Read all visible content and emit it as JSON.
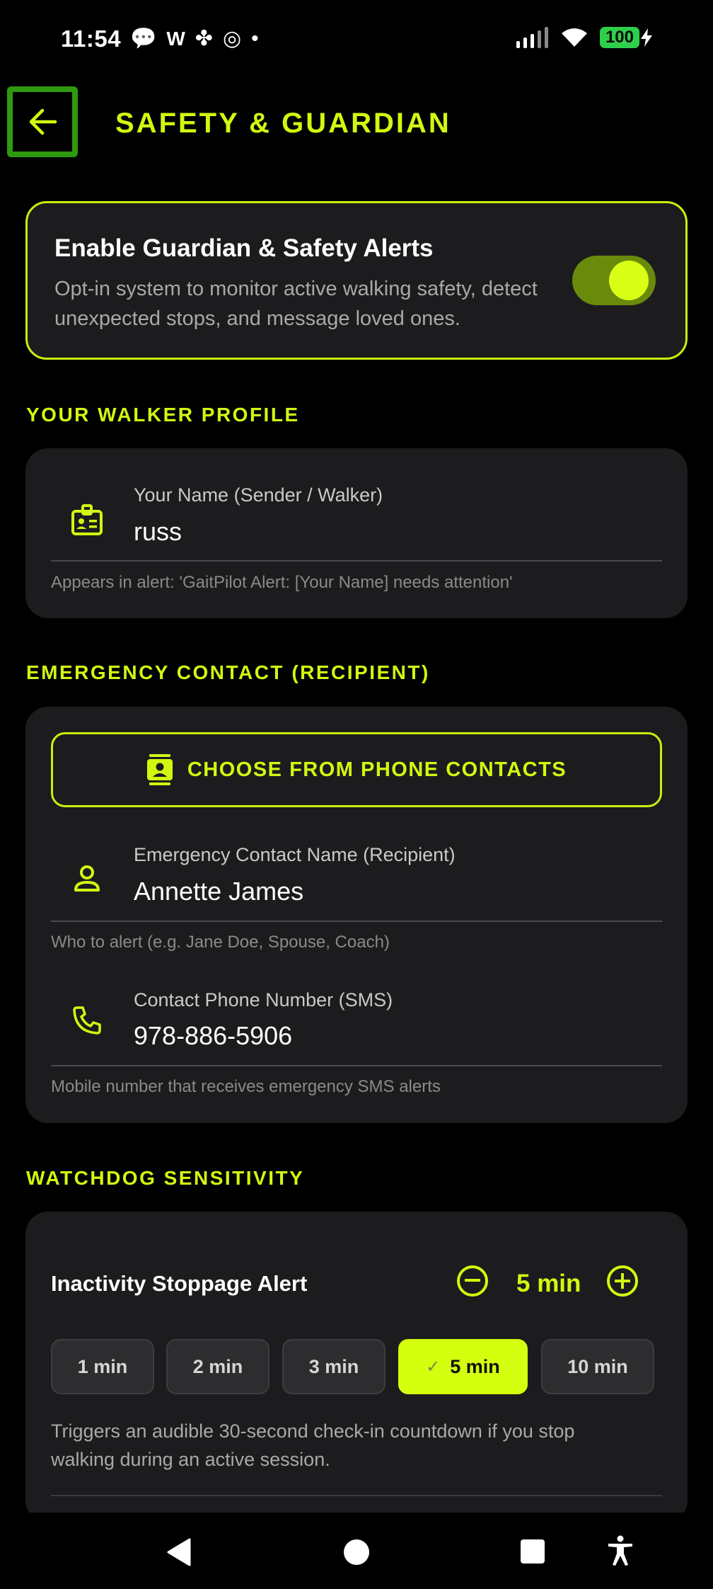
{
  "status_bar": {
    "time": "11:54",
    "notification_icons": [
      "speech-bubble-icon",
      "w-app-icon",
      "pinwheel-icon",
      "spiral-icon",
      "dot-icon"
    ],
    "notification_glyphs": [
      "💬",
      "W",
      "✤",
      "◎",
      "•"
    ],
    "battery": "100"
  },
  "header": {
    "title": "SAFETY & GUARDIAN"
  },
  "enable_card": {
    "title": "Enable Guardian & Safety Alerts",
    "description": "Opt-in system to monitor active walking safety, detect unexpected stops, and message loved ones.",
    "toggle_on": true
  },
  "walker_profile": {
    "section_title": "YOUR WALKER PROFILE",
    "name_label": "Your Name (Sender / Walker)",
    "name_value": "russ",
    "hint": "Appears in alert: 'GaitPilot Alert: [Your Name] needs attention'"
  },
  "emergency_contact": {
    "section_title": "EMERGENCY CONTACT (RECIPIENT)",
    "choose_button": "CHOOSE FROM PHONE CONTACTS",
    "name_label": "Emergency Contact Name (Recipient)",
    "name_value": "Annette James",
    "name_hint": "Who to alert (e.g. Jane Doe, Spouse, Coach)",
    "phone_label": "Contact Phone Number (SMS)",
    "phone_value": "978-886-5906",
    "phone_hint": "Mobile number that receives emergency SMS alerts"
  },
  "watchdog": {
    "section_title": "WATCHDOG SENSITIVITY",
    "inactivity_title": "Inactivity Stoppage Alert",
    "current_value": "5 min",
    "options": [
      "1 min",
      "2 min",
      "3 min",
      "5 min",
      "10 min"
    ],
    "selected_option": "5 min",
    "description": "Triggers an audible 30-second check-in countdown if you stop walking during an active session."
  },
  "colors": {
    "accent": "#d4f70f",
    "background": "#000000",
    "card": "#1c1c1e",
    "back_button_border": "#2e9a10",
    "battery": "#2ed04b"
  }
}
